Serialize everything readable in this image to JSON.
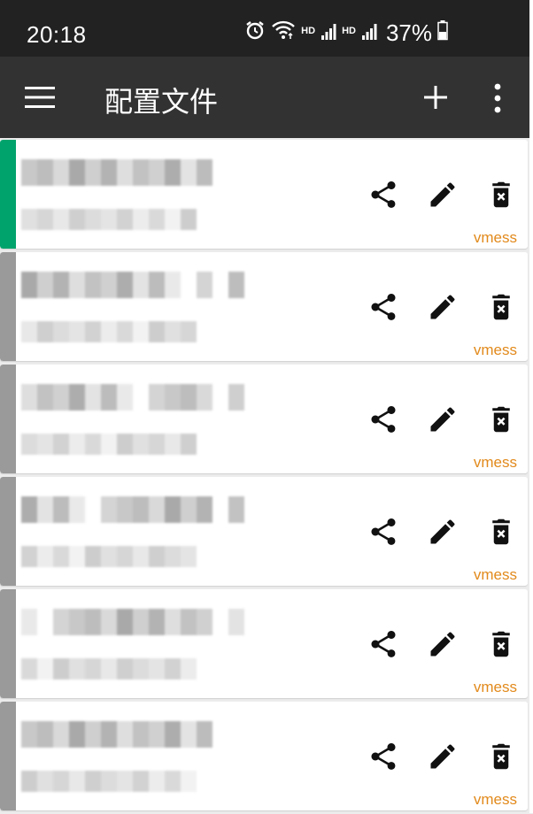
{
  "status_bar": {
    "time": "20:18",
    "hd1": "HD",
    "hd2": "HD",
    "battery": "37%",
    "icons": [
      "alarm-icon",
      "wifi-icon",
      "signal-icon",
      "signal-icon",
      "battery-icon"
    ]
  },
  "app_bar": {
    "title": "配置文件",
    "menu_icon": "hamburger-menu-icon",
    "add_icon": "plus-icon",
    "more_icon": "more-vertical-icon"
  },
  "colors": {
    "active_indicator": "#00a36c",
    "inactive_indicator": "#9a9a9a",
    "type_label": "#e28a1c"
  },
  "profiles": [
    {
      "type": "vmess",
      "active": true
    },
    {
      "type": "vmess",
      "active": false
    },
    {
      "type": "vmess",
      "active": false
    },
    {
      "type": "vmess",
      "active": false
    },
    {
      "type": "vmess",
      "active": false
    },
    {
      "type": "vmess",
      "active": false
    }
  ]
}
